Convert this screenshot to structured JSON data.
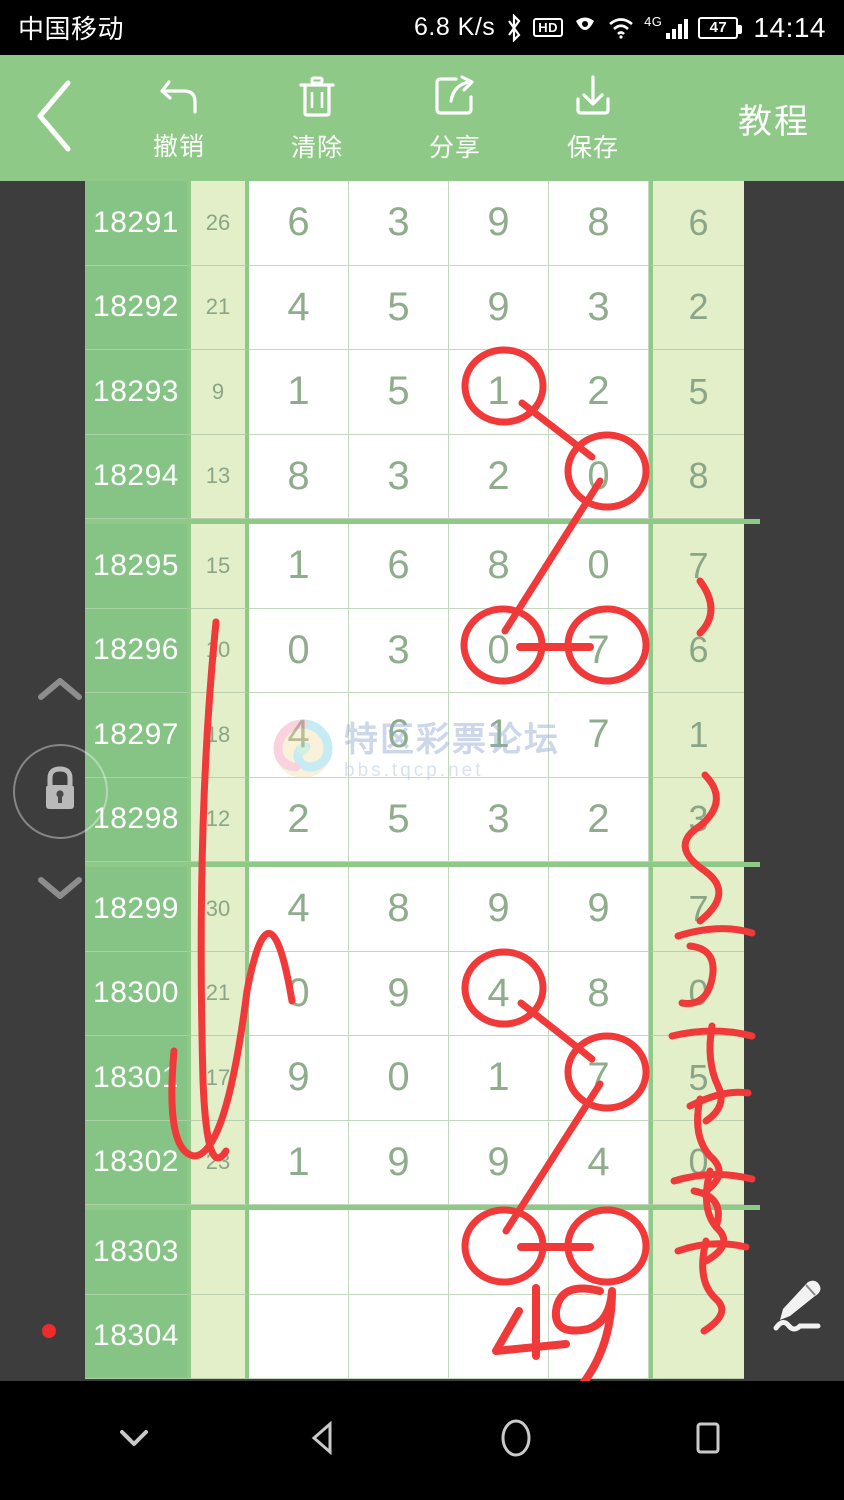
{
  "status_bar": {
    "carrier": "中国移动",
    "net_speed": "6.8 K/s",
    "bluetooth_icon": "bluetooth-icon",
    "hd_label": "HD",
    "eye_icon": "eye-care-icon",
    "wifi_icon": "wifi-icon",
    "network_type": "4G",
    "signal_icon": "signal-bars-icon",
    "battery_level": "47",
    "time": "14:14"
  },
  "toolbar": {
    "back_icon": "back-chevron-icon",
    "items": [
      {
        "label": "撤销",
        "icon": "undo-icon"
      },
      {
        "label": "清除",
        "icon": "trash-icon"
      },
      {
        "label": "分享",
        "icon": "share-icon"
      },
      {
        "label": "保存",
        "icon": "download-icon"
      }
    ],
    "tutorial_label": "教程",
    "bg_color": "#8fc987"
  },
  "side_controls": {
    "up_chevron_icon": "chevron-up-icon",
    "lock_icon": "lock-icon",
    "down_chevron_icon": "chevron-down-icon",
    "record_dot": "red-dot-indicator",
    "pencil_icon": "pencil-edit-icon"
  },
  "watermark": {
    "logo_icon": "spiral-logo-icon",
    "title": "特区彩票论坛",
    "url": "bbs.tqcp.net"
  },
  "table": {
    "colors": {
      "issue_bg": "#85c485",
      "sum_bg": "#e3efc9",
      "digit_bg": "#ffffff",
      "last_bg": "#e3efc9",
      "digit_text": "#8fad8c",
      "grid": "#8fc987",
      "ink": "#f03a3a"
    },
    "rows": [
      {
        "issue": "18291",
        "sum": "26",
        "digits": [
          "6",
          "3",
          "9",
          "8"
        ],
        "last": "6",
        "group_end": false
      },
      {
        "issue": "18292",
        "sum": "21",
        "digits": [
          "4",
          "5",
          "9",
          "3"
        ],
        "last": "2",
        "group_end": false
      },
      {
        "issue": "18293",
        "sum": "9",
        "digits": [
          "1",
          "5",
          "1",
          "2"
        ],
        "last": "5",
        "group_end": false
      },
      {
        "issue": "18294",
        "sum": "13",
        "digits": [
          "8",
          "3",
          "2",
          "0"
        ],
        "last": "8",
        "group_end": true
      },
      {
        "issue": "18295",
        "sum": "15",
        "digits": [
          "1",
          "6",
          "8",
          "0"
        ],
        "last": "7",
        "group_end": false
      },
      {
        "issue": "18296",
        "sum": "10",
        "digits": [
          "0",
          "3",
          "0",
          "7"
        ],
        "last": "6",
        "group_end": false
      },
      {
        "issue": "18297",
        "sum": "18",
        "digits": [
          "4",
          "6",
          "1",
          "7"
        ],
        "last": "1",
        "group_end": false
      },
      {
        "issue": "18298",
        "sum": "12",
        "digits": [
          "2",
          "5",
          "3",
          "2"
        ],
        "last": "3",
        "group_end": true
      },
      {
        "issue": "18299",
        "sum": "30",
        "digits": [
          "4",
          "8",
          "9",
          "9"
        ],
        "last": "7",
        "group_end": false
      },
      {
        "issue": "18300",
        "sum": "21",
        "digits": [
          "0",
          "9",
          "4",
          "8"
        ],
        "last": "0",
        "group_end": false
      },
      {
        "issue": "18301",
        "sum": "17",
        "digits": [
          "9",
          "0",
          "1",
          "7"
        ],
        "last": "5",
        "group_end": false
      },
      {
        "issue": "18302",
        "sum": "23",
        "digits": [
          "1",
          "9",
          "9",
          "4"
        ],
        "last": "0",
        "group_end": true
      },
      {
        "issue": "18303",
        "sum": "",
        "digits": [
          "",
          "",
          "",
          ""
        ],
        "last": "",
        "group_end": false
      },
      {
        "issue": "18304",
        "sum": "",
        "digits": [
          "",
          "",
          "",
          ""
        ],
        "last": "",
        "group_end": false
      }
    ]
  },
  "annotations": {
    "handwritten_number": "49",
    "ink_color": "#f03a3a"
  },
  "nav_bar": {
    "hide_icon": "chevron-down-icon",
    "back_icon": "back-triangle-icon",
    "home_icon": "home-circle-icon",
    "recents_icon": "recents-square-icon"
  }
}
